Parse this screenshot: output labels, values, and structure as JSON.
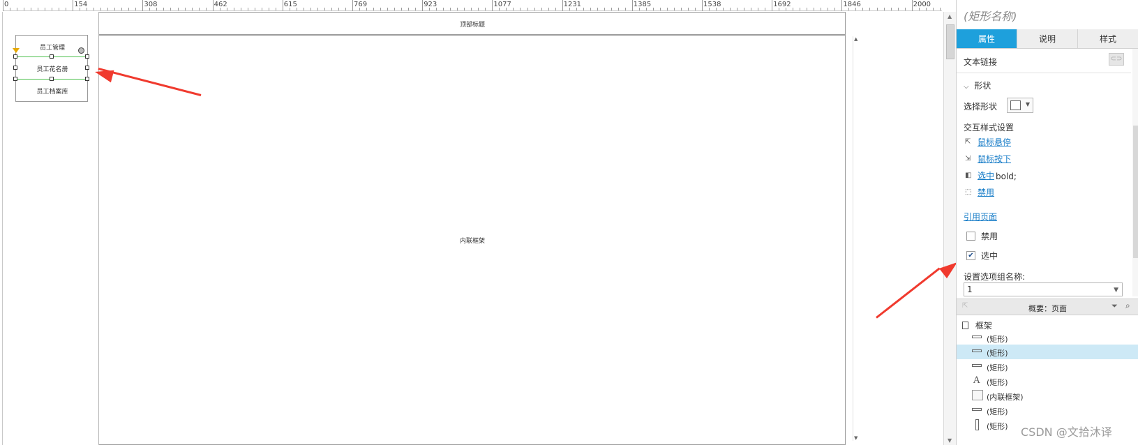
{
  "ruler": {
    "labels": [
      "0",
      "154",
      "308",
      "462",
      "615",
      "769",
      "923",
      "1077",
      "1231",
      "1385",
      "1538",
      "1692",
      "1846",
      "2000"
    ]
  },
  "canvas": {
    "menu_items": [
      "员工管理",
      "员工花名册",
      "员工档案库"
    ],
    "header_label": "顶部标题",
    "iframe_label": "内联框架"
  },
  "inspector": {
    "shape_name_placeholder": "(矩形名称)",
    "tabs": [
      "属性",
      "说明",
      "样式"
    ],
    "active_tab": "属性",
    "text_link_label": "文本链接",
    "shape_section_title": "形状",
    "select_shape_label": "选择形状",
    "interaction_style_title": "交互样式设置",
    "style_links": [
      "鼠标悬停",
      "鼠标按下",
      "选中",
      "禁用"
    ],
    "selected_style_value": "bold;",
    "reference_page_link": "引用页面",
    "checkbox_disabled_label": "禁用",
    "checkbox_disabled_checked": false,
    "checkbox_selected_label": "选中",
    "checkbox_selected_checked": true,
    "group_name_label": "设置选项组名称:",
    "group_name_value": "1"
  },
  "outline": {
    "title": "概要：页面",
    "root": "框架",
    "items": [
      {
        "label": "(矩形)",
        "icon": "line-shape-icon",
        "selected": false
      },
      {
        "label": "(矩形)",
        "icon": "line-shape-icon",
        "selected": true
      },
      {
        "label": "(矩形)",
        "icon": "line-shape-icon",
        "selected": false
      },
      {
        "label": "(矩形)",
        "icon": "text-shape-icon",
        "selected": false
      },
      {
        "label": "(内联框架)",
        "icon": "iframe-shape-icon",
        "selected": false
      },
      {
        "label": "(矩形)",
        "icon": "line-shape-icon",
        "selected": false
      },
      {
        "label": "(矩形)",
        "icon": "vertical-rect-icon",
        "selected": false
      }
    ]
  },
  "watermark": "CSDN @文拾沐译",
  "colors": {
    "accent_tab": "#1ea0dc",
    "link": "#1a7ec8",
    "selection_line": "#4cc04c",
    "annotation_arrow": "#f03a2e",
    "outline_selected": "#cde9f6"
  }
}
